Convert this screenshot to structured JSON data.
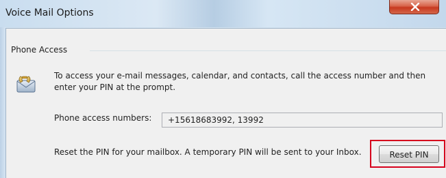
{
  "window": {
    "title": "Voice Mail Options",
    "close_glyph": "X"
  },
  "phone_access": {
    "header": "Phone Access",
    "icon": "voicemail-icon",
    "description": "To access your e-mail messages, calendar, and contacts, call the access number and then enter your PIN at the prompt.",
    "numbers_label": "Phone access numbers:",
    "numbers_value": "+15618683992, 13992",
    "reset_text": "Reset the PIN for your mailbox. A temporary PIN will be sent to your Inbox.",
    "reset_button_label": "Reset PIN"
  },
  "colors": {
    "highlight_border": "#d6001c",
    "close_button": "#c7391f",
    "titlebar": "#c9ddef"
  }
}
